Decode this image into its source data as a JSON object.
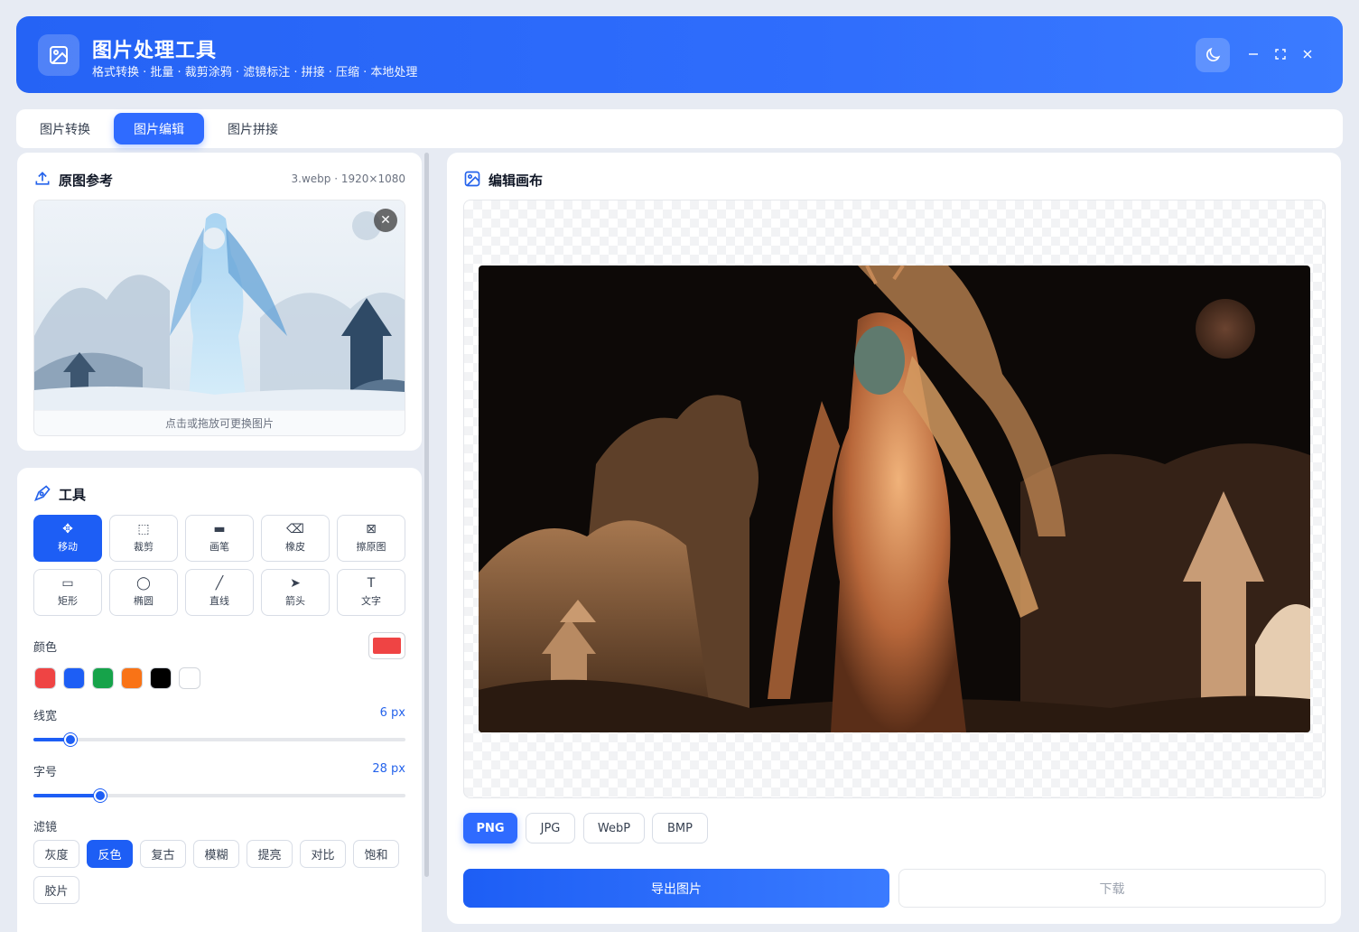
{
  "header": {
    "title": "图片处理工具",
    "subtitle": "格式转换 · 批量 · 裁剪涂鸦 · 滤镜标注 · 拼接 · 压缩 · 本地处理",
    "logo_icon": "image-icon",
    "theme_icon": "moon-icon"
  },
  "tabs": [
    {
      "label": "图片转换",
      "active": false
    },
    {
      "label": "图片编辑",
      "active": true
    },
    {
      "label": "图片拼接",
      "active": false
    }
  ],
  "reference": {
    "title": "原图参考",
    "meta": "3.webp · 1920×1080",
    "hint": "点击或拖放可更换图片",
    "close_label": "✕"
  },
  "tools": {
    "title": "工具",
    "items": [
      {
        "label": "移动",
        "icon": "move-icon",
        "glyph": "✥",
        "active": true
      },
      {
        "label": "裁剪",
        "icon": "crop-icon",
        "glyph": "⬚",
        "active": false
      },
      {
        "label": "画笔",
        "icon": "brush-icon",
        "glyph": "▬",
        "active": false
      },
      {
        "label": "橡皮",
        "icon": "eraser-icon",
        "glyph": "⌫",
        "active": false
      },
      {
        "label": "擦原图",
        "icon": "erase-original-icon",
        "glyph": "⊠",
        "active": false
      },
      {
        "label": "矩形",
        "icon": "rectangle-icon",
        "glyph": "▭",
        "active": false
      },
      {
        "label": "椭圆",
        "icon": "ellipse-icon",
        "glyph": "◯",
        "active": false
      },
      {
        "label": "直线",
        "icon": "line-icon",
        "glyph": "╱",
        "active": false
      },
      {
        "label": "箭头",
        "icon": "arrow-icon",
        "glyph": "➤",
        "active": false
      },
      {
        "label": "文字",
        "icon": "text-icon",
        "glyph": "T",
        "active": false
      }
    ],
    "color_label": "颜色",
    "current_color": "#ef4444",
    "swatches": [
      "#ef4444",
      "#1d5ef5",
      "#16a34a",
      "#f97316",
      "#000000",
      "#ffffff"
    ],
    "line_width_label": "线宽",
    "line_width_value": "6 px",
    "line_width_fraction": 0.1,
    "font_size_label": "字号",
    "font_size_value": "28 px",
    "font_size_fraction": 0.18,
    "filter_label": "滤镜",
    "filters": [
      {
        "label": "灰度",
        "active": false
      },
      {
        "label": "反色",
        "active": true
      },
      {
        "label": "复古",
        "active": false
      },
      {
        "label": "模糊",
        "active": false
      },
      {
        "label": "提亮",
        "active": false
      },
      {
        "label": "对比",
        "active": false
      },
      {
        "label": "饱和",
        "active": false
      },
      {
        "label": "胶片",
        "active": false
      }
    ]
  },
  "canvas": {
    "title": "编辑画布",
    "formats": [
      {
        "label": "PNG",
        "active": true
      },
      {
        "label": "JPG",
        "active": false
      },
      {
        "label": "WebP",
        "active": false
      },
      {
        "label": "BMP",
        "active": false
      }
    ],
    "export_label": "导出图片",
    "download_label": "下载"
  },
  "colors": {
    "accent": "#2f6bff",
    "header_bg": "#2563f5"
  }
}
